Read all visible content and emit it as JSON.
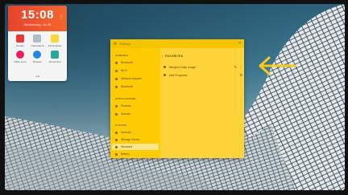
{
  "clock": {
    "time": "15:08",
    "date": "Wednesday, Jul 26",
    "menu_icon": "overflow-menu-icon",
    "apps": [
      {
        "label": "Google",
        "color": "#e53935"
      },
      {
        "label": "Calculadora",
        "color": "#b0bec5"
      },
      {
        "label": "File Explorer",
        "color": "#fdd835"
      },
      {
        "label": "Office Lens",
        "color": "#e91e63"
      },
      {
        "label": "Browser",
        "color": "#1e88e5"
      },
      {
        "label": "Screenshot",
        "color": "#26a69a"
      }
    ],
    "footer": "Add"
  },
  "window": {
    "title": "Settings",
    "close_icon": "close-icon",
    "sidebar": {
      "sections": [
        {
          "header": "GENERAL",
          "items": [
            "Bluetooth",
            "Wi-Fi",
            "Network Adapter",
            "Bluetooth"
          ]
        },
        {
          "header": "APPLICATIONS",
          "items": [
            "Pictures",
            "Sounds"
          ]
        },
        {
          "header": "SYSTEM",
          "items": [
            "Devices",
            "Storage Sense",
            "Windows",
            "Battery"
          ]
        }
      ],
      "active_item": "Windows"
    },
    "content": {
      "header": "FAVORITES",
      "rows": [
        {
          "label": "Weight's Daily Image",
          "actions": [
            "✎",
            "⋮"
          ]
        },
        {
          "label": "Add Programs",
          "actions": [
            "⚙"
          ]
        }
      ]
    }
  },
  "annotation": {
    "arrow_color": "#f7c81e",
    "direction": "left"
  }
}
